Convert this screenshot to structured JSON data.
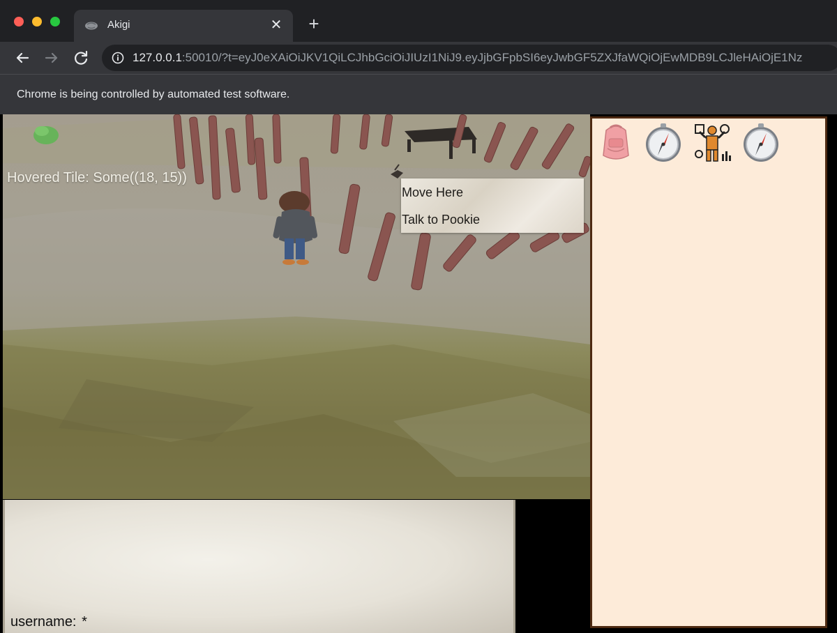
{
  "browser": {
    "tab": {
      "title": "Akigi"
    },
    "address": {
      "host": "127.0.0.1",
      "rest": ":50010/?t=eyJ0eXAiOiJKV1QiLCJhbGciOiJIUzI1NiJ9.eyJjbGFpbSI6eyJwbGF5ZXJfaWQiOjEwMDB9LCJleHAiOjE1Nz"
    },
    "infobar": "Chrome is being controlled by automated test software."
  },
  "game": {
    "hovered_tile": "Hovered Tile: Some((18, 15))",
    "context_menu": [
      "Move Here",
      "Talk to Pookie"
    ],
    "chat": {
      "prompt_label": "username:",
      "prompt_value": "*"
    }
  },
  "side_panel": {
    "icons": [
      "backpack-icon",
      "compass-icon",
      "skills-icon",
      "compass-icon"
    ]
  }
}
